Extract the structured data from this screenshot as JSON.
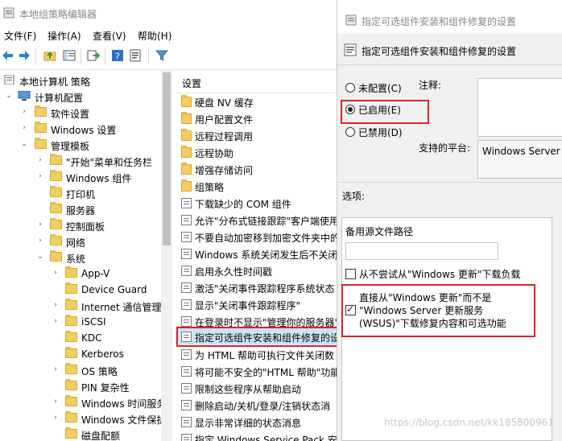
{
  "window": {
    "title": "本地组策略编辑器"
  },
  "menu": [
    "文件(F)",
    "操作(A)",
    "查看(V)",
    "帮助(H)"
  ],
  "toolbar": [
    "back-icon",
    "forward-icon",
    "up-folder-icon",
    "show-hide-tree-icon",
    "export-list-icon",
    "help-icon",
    "properties-icon",
    "filter-icon"
  ],
  "tree": {
    "root": "本地计算机 策略",
    "computer_config": "计算机配置",
    "software": "软件设置",
    "windows_settings": "Windows 设置",
    "admin_templates": "管理模板",
    "start_menu": "\"开始\"菜单和任务栏",
    "windows_components": "Windows 组件",
    "printers": "打印机",
    "server": "服务器",
    "control_panel": "控制面板",
    "network": "网络",
    "system": "系统",
    "system_children": [
      "App-V",
      "Device Guard",
      "Internet 通信管理",
      "iSCSI",
      "KDC",
      "Kerberos",
      "OS 策略",
      "PIN 复杂性",
      "Windows 时间服务",
      "Windows 文件保护",
      "磁盘配额"
    ]
  },
  "list": {
    "header": "设置",
    "folders": [
      "硬盘 NV 缓存",
      "用户配置文件",
      "远程过程调用",
      "远程协助",
      "增强存储访问",
      "组策略"
    ],
    "settings": [
      "下载缺少的 COM 组件",
      "允许\"分布式链接跟踪\"客户端使用",
      "不要自动加密移到加密文件夹中的",
      "Windows 系统关闭发生后不关闭",
      "启用永久性时间戳",
      "激活\"关闭事件跟踪程序系统状态",
      "显示\"关闭事件跟踪程序\"",
      "在登录时不显示\"管理你的服务器\"",
      "指定可选组件安装和组件修复的设",
      "为 HTML 帮助可执行文件关闭数",
      "将可能不安全的\"HTML 帮助\"功能",
      "限制这些程序从帮助启动",
      "删除启动/关机/登录/注销状态消",
      "显示非常详细的状态消息",
      "指定 Windows Service Pack 安"
    ],
    "selected_index": 8
  },
  "dialog": {
    "title": "指定可选组件安装和组件修复的设置",
    "heading": "指定可选组件安装和组件修复的设置",
    "radio_not_configured": "未配置(C)",
    "radio_enabled": "已启用(E)",
    "radio_disabled": "已禁用(D)",
    "selected_radio": "已启用(E)",
    "comment_label": "注释:",
    "supported_label": "支持的平台:",
    "supported_value": "Windows Server 2",
    "options_label": "选项:",
    "alt_source_label": "备用源文件路径",
    "alt_source_value": "",
    "chk_no_wu": "从不尝试从\"Windows 更新\"下载负载",
    "chk_no_wu_checked": false,
    "chk_direct_wu": "直接从\"Windows 更新\"而不是\"Windows Server 更新服务(WSUS)\"下载修复内容和可选功能",
    "chk_direct_wu_line1": "直接从\"Windows 更新\"而不是",
    "chk_direct_wu_line2": "\"Windows Server 更新服务",
    "chk_direct_wu_line3": "(WSUS)\"下载修复内容和可选功能",
    "chk_direct_wu_checked": true
  },
  "watermark": "https://blog.csdn.net/kk185800961",
  "colors": {
    "highlight": "#e0212a",
    "selection": "#cce4f7",
    "folder": "#f3cd62"
  }
}
